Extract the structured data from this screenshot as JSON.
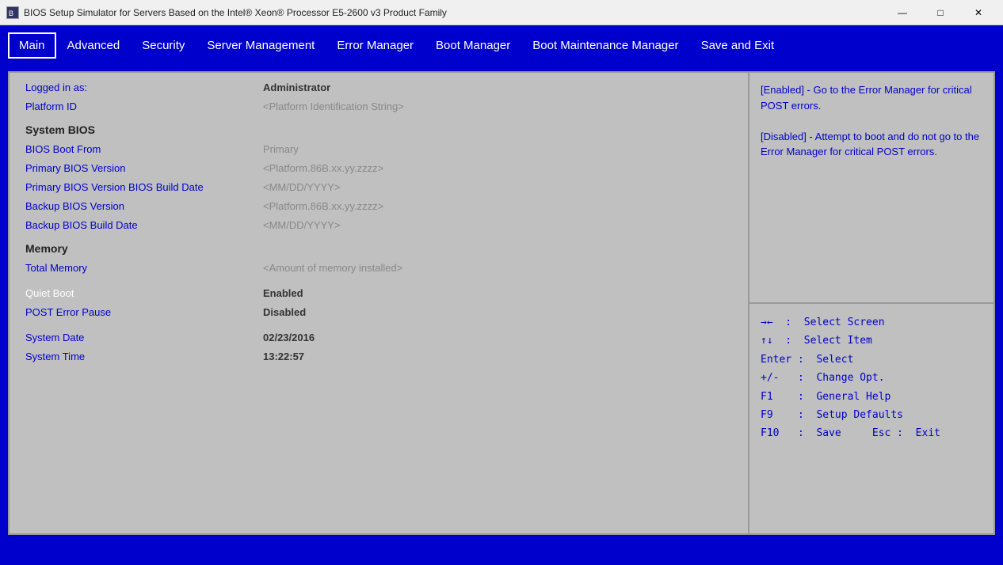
{
  "titlebar": {
    "title": "BIOS Setup Simulator for Servers Based on the Intel® Xeon® Processor E5-2600 v3 Product Family",
    "minimize": "—",
    "maximize": "□",
    "close": "✕"
  },
  "nav": {
    "tabs": [
      {
        "label": "Main",
        "active": true
      },
      {
        "label": "Advanced",
        "active": false
      },
      {
        "label": "Security",
        "active": false
      },
      {
        "label": "Server Management",
        "active": false
      },
      {
        "label": "Error Manager",
        "active": false
      },
      {
        "label": "Boot Manager",
        "active": false
      },
      {
        "label": "Boot Maintenance Manager",
        "active": false
      },
      {
        "label": "Save and Exit",
        "active": false
      }
    ]
  },
  "main": {
    "rows": [
      {
        "label": "Logged in as:",
        "value": "Administrator",
        "type": "info"
      },
      {
        "label": "Platform ID",
        "value": "<Platform Identification String>",
        "type": "info"
      }
    ],
    "bios_section": "System BIOS",
    "bios_rows": [
      {
        "label": "BIOS Boot From",
        "value": "Primary"
      },
      {
        "label": "Primary BIOS Version",
        "value": "<Platform.86B.xx.yy.zzzz>"
      },
      {
        "label": "Primary BIOS Version BIOS Build Date",
        "value": "<MM/DD/YYYY>"
      },
      {
        "label": "Backup BIOS Version",
        "value": "<Platform.86B.xx.yy.zzzz>"
      },
      {
        "label": "Backup BIOS Build Date",
        "value": "<MM/DD/YYYY>"
      }
    ],
    "memory_section": "Memory",
    "memory_rows": [
      {
        "label": "Total Memory",
        "value": "<Amount of memory installed>"
      }
    ],
    "other_rows": [
      {
        "label": "Quiet Boot",
        "value": "Enabled",
        "white": true
      },
      {
        "label": "POST Error Pause",
        "value": "Disabled",
        "white": true
      }
    ],
    "date_rows": [
      {
        "label": "System Date",
        "value": "02/23/2016"
      },
      {
        "label": "System Time",
        "value": "13:22:57"
      }
    ]
  },
  "help": {
    "text": "[Enabled] - Go to the Error Manager for critical POST errors. [Disabled] - Attempt to boot and do not go to the Error Manager for critical POST errors."
  },
  "keybinds": [
    {
      "key": "→←",
      "action": "Select Screen"
    },
    {
      "key": "↑↓",
      "action": "Select Item"
    },
    {
      "key": "Enter",
      "action": "Select"
    },
    {
      "key": "+/-",
      "action": "Change Opt."
    },
    {
      "key": "F1",
      "action": "General Help"
    },
    {
      "key": "F9",
      "action": "Setup Defaults"
    },
    {
      "key": "F10",
      "action": "Save"
    },
    {
      "key": "Esc",
      "action": "Exit"
    }
  ]
}
